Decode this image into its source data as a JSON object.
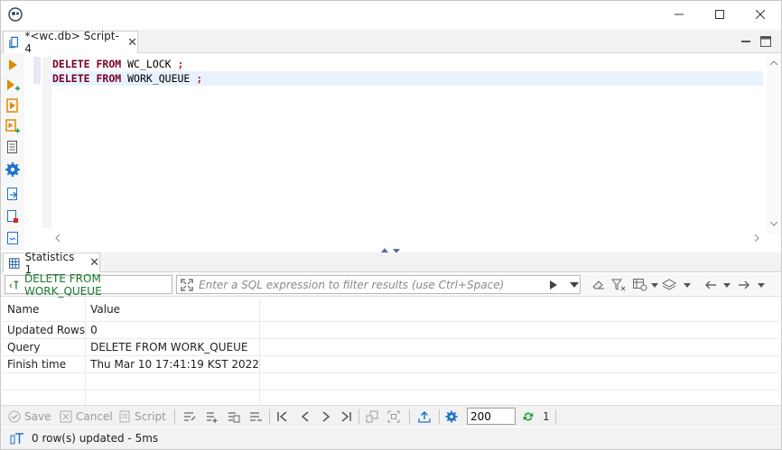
{
  "editor_tab": {
    "label": "*<wc.db> Script-4"
  },
  "code_lines": [
    {
      "kw1": "DELETE",
      "kw2": "FROM",
      "ident": "WC_LOCK",
      "punct": ";"
    },
    {
      "kw1": "DELETE",
      "kw2": "FROM",
      "ident": "WORK_QUEUE",
      "punct": ";"
    }
  ],
  "results_tab": {
    "label": "Statistics 1"
  },
  "filter": {
    "query": "DELETE FROM WORK_QUEUE",
    "placeholder": "Enter a SQL expression to filter results (use Ctrl+Space)"
  },
  "grid": {
    "headers": [
      "Name",
      "Value"
    ],
    "rows": [
      [
        "Updated Rows",
        "0"
      ],
      [
        "Query",
        "DELETE FROM WORK_QUEUE"
      ],
      [
        "Finish time",
        "Thu Mar 10 17:41:19 KST 2022"
      ]
    ]
  },
  "bottom_toolbar": {
    "save": "Save",
    "cancel": "Cancel",
    "script": "Script",
    "fetch_size": "200",
    "refresh_count": "1"
  },
  "status": {
    "text": "0 row(s) updated - 5ms"
  },
  "colors": {
    "keyword": "#7a0026",
    "accent": "#1f73c9",
    "green": "#1a9a3a",
    "orange": "#e08a00"
  }
}
